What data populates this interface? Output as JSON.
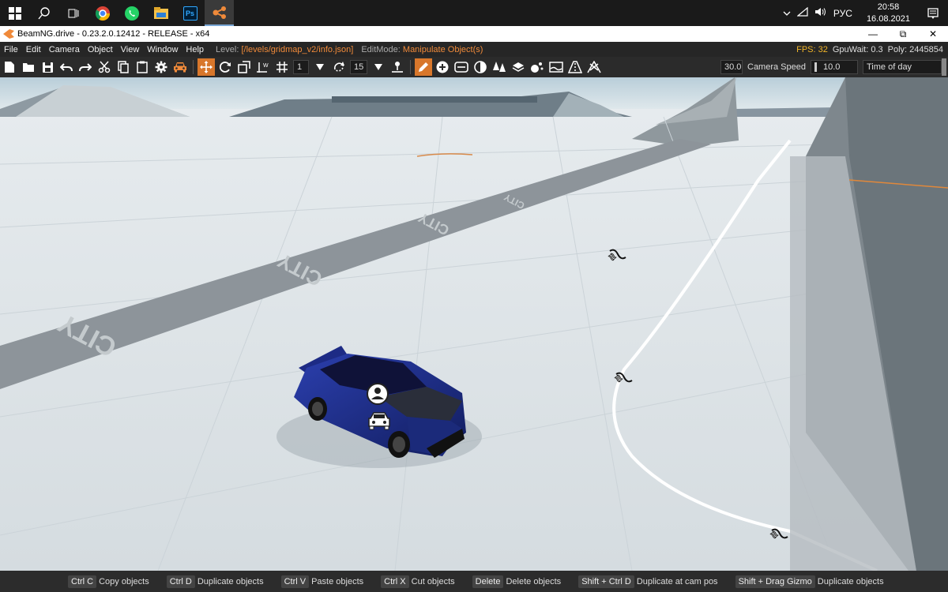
{
  "taskbar": {
    "icons": [
      "windows-start-icon",
      "search-icon",
      "task-view-icon",
      "chrome-icon",
      "whatsapp-icon",
      "file-explorer-icon",
      "photoshop-icon",
      "beamng-icon"
    ],
    "ps_label": "Ps",
    "language": "РУС",
    "time": "20:58",
    "date": "16.08.2021"
  },
  "window": {
    "title": "BeamNG.drive - 0.23.2.0.12412 - RELEASE - x64",
    "minimize": "—",
    "restore": "⧉",
    "close": "✕"
  },
  "menu": {
    "items": [
      "File",
      "Edit",
      "Camera",
      "Object",
      "View",
      "Window",
      "Help"
    ],
    "level_label": "Level:",
    "level_value": "[/levels/gridmap_v2/info.json]",
    "editmode_label": "EditMode:",
    "editmode_value": "Manipulate Object(s)",
    "fps": "FPS: 32",
    "gpuwait": "GpuWait: 0.3",
    "poly": "Poly: 2445854"
  },
  "toolbar": {
    "snap_value": "1",
    "rotate_snap_value": "15",
    "camera_field_value": "30.0",
    "camera_speed_label": "Camera Speed",
    "camera_speed_value": "10.0",
    "time_of_day_label": "Time of day"
  },
  "scene": {
    "road_text": "CITY"
  },
  "shortcuts": [
    {
      "key": "Ctrl C",
      "action": "Copy objects"
    },
    {
      "key": "Ctrl D",
      "action": "Duplicate objects"
    },
    {
      "key": "Ctrl V",
      "action": "Paste objects"
    },
    {
      "key": "Ctrl X",
      "action": "Cut objects"
    },
    {
      "key": "Delete",
      "action": "Delete objects"
    },
    {
      "key": "Shift + Ctrl D",
      "action": "Duplicate at cam pos"
    },
    {
      "key": "Shift + Drag Gizmo",
      "action": "Duplicate objects"
    }
  ],
  "colors": {
    "accent": "#f08a3a",
    "fps": "#f0b429",
    "car": "#1e2f8c"
  }
}
